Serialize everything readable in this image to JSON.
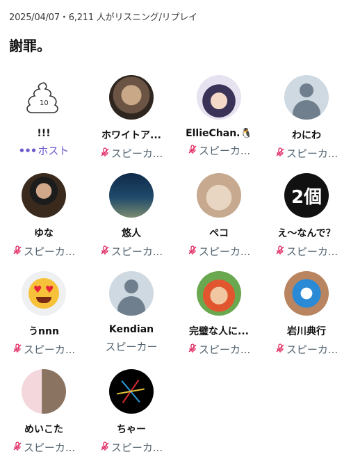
{
  "header": {
    "meta": "2025/04/07・6,211 人がリスニング/リプレイ",
    "title": "謝罪。"
  },
  "participants": [
    {
      "name": "!!!",
      "role": "ホスト",
      "role_type": "host",
      "avatar": "poop-doodle"
    },
    {
      "name": "ホワイトア...",
      "role": "スピーカ...",
      "role_type": "speaker-muted",
      "avatar": "photo-face"
    },
    {
      "name": "EllieChan.🐧",
      "role": "スピーカ...",
      "role_type": "speaker-muted",
      "avatar": "anime-girl"
    },
    {
      "name": "わにわ",
      "role": "スピーカ...",
      "role_type": "speaker-muted",
      "avatar": "default-person"
    },
    {
      "name": "ゆな",
      "role": "スピーカ...",
      "role_type": "speaker-muted",
      "avatar": "man-suit"
    },
    {
      "name": "悠人",
      "role": "スピーカ...",
      "role_type": "speaker-muted",
      "avatar": "underwater"
    },
    {
      "name": "ペコ",
      "role": "スピーカ...",
      "role_type": "speaker-muted",
      "avatar": "hamster"
    },
    {
      "name": "え～なんで？",
      "role": "スピーカ...",
      "role_type": "speaker-muted",
      "avatar": "text-2ko",
      "avatar_text": "2個"
    },
    {
      "name": "うnnn",
      "role": "スピーカ...",
      "role_type": "speaker-muted",
      "avatar": "heart-eyes-emoji"
    },
    {
      "name": "Kendian",
      "role": "スピーカー",
      "role_type": "speaker",
      "avatar": "default-person"
    },
    {
      "name": "完璧な人に...",
      "role": "スピーカ...",
      "role_type": "speaker-muted",
      "avatar": "waddle-dee"
    },
    {
      "name": "岩川典行",
      "role": "スピーカ...",
      "role_type": "speaker-muted",
      "avatar": "blue-robot"
    },
    {
      "name": "めいこた",
      "role": "スピーカ...",
      "role_type": "speaker-muted",
      "avatar": "owl"
    },
    {
      "name": "ちゃー",
      "role": "スピーカ...",
      "role_type": "speaker-muted",
      "avatar": "fireworks"
    }
  ]
}
